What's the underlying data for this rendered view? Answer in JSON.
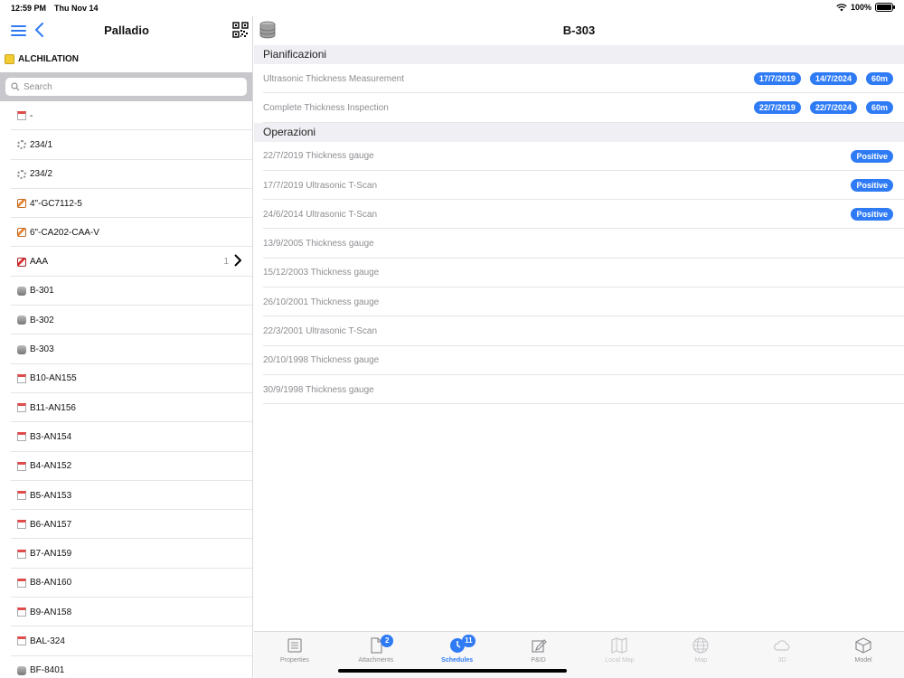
{
  "status": {
    "time": "12:59 PM",
    "date": "Thu Nov 14",
    "battery": "100%",
    "battery_level": 1.0
  },
  "sidebar": {
    "title": "Palladio",
    "plant": "ALCHILATION",
    "search_placeholder": "Search",
    "items": [
      {
        "label": "-",
        "icon": "doc-icon"
      },
      {
        "label": "234/1",
        "icon": "gear-icon"
      },
      {
        "label": "234/2",
        "icon": "gear-icon"
      },
      {
        "label": "4\"-GC7112-5",
        "icon": "pipe-icon"
      },
      {
        "label": "6\"-CA202-CAA-V",
        "icon": "pipe-icon"
      },
      {
        "label": "AAA",
        "icon": "pipe-red-icon",
        "count": "1"
      },
      {
        "label": "B-301",
        "icon": "tank-icon"
      },
      {
        "label": "B-302",
        "icon": "tank-icon"
      },
      {
        "label": "B-303",
        "icon": "tank-icon"
      },
      {
        "label": "B10-AN155",
        "icon": "doc-icon"
      },
      {
        "label": "B11-AN156",
        "icon": "doc-icon"
      },
      {
        "label": "B3-AN154",
        "icon": "doc-icon"
      },
      {
        "label": "B4-AN152",
        "icon": "doc-icon"
      },
      {
        "label": "B5-AN153",
        "icon": "doc-icon"
      },
      {
        "label": "B6-AN157",
        "icon": "doc-icon"
      },
      {
        "label": "B7-AN159",
        "icon": "doc-icon"
      },
      {
        "label": "B8-AN160",
        "icon": "doc-icon"
      },
      {
        "label": "B9-AN158",
        "icon": "doc-icon"
      },
      {
        "label": "BAL-324",
        "icon": "doc-icon"
      },
      {
        "label": "BF-8401",
        "icon": "tank-icon"
      }
    ]
  },
  "main": {
    "title": "B-303",
    "planning_header": "Pianificazioni",
    "planning": [
      {
        "name": "Ultrasonic Thickness Measurement",
        "start": "17/7/2019",
        "end": "14/7/2024",
        "interval": "60m"
      },
      {
        "name": "Complete Thickness Inspection",
        "start": "22/7/2019",
        "end": "22/7/2024",
        "interval": "60m"
      }
    ],
    "operations_header": "Operazioni",
    "operations": [
      {
        "label": "22/7/2019 Thickness gauge",
        "result": "Positive"
      },
      {
        "label": "17/7/2019 Ultrasonic T-Scan",
        "result": "Positive"
      },
      {
        "label": "24/6/2014 Ultrasonic T-Scan",
        "result": "Positive"
      },
      {
        "label": "13/9/2005 Thickness gauge",
        "result": ""
      },
      {
        "label": "15/12/2003 Thickness gauge",
        "result": ""
      },
      {
        "label": "26/10/2001 Thickness gauge",
        "result": ""
      },
      {
        "label": "22/3/2001 Ultrasonic T-Scan",
        "result": ""
      },
      {
        "label": "20/10/1998 Thickness gauge",
        "result": ""
      },
      {
        "label": "30/9/1998 Thickness gauge",
        "result": ""
      }
    ]
  },
  "tabs": [
    {
      "label": "Properties",
      "icon": "properties-icon",
      "state": "normal",
      "badge": ""
    },
    {
      "label": "Attachments",
      "icon": "attachments-icon",
      "state": "normal",
      "badge": "2"
    },
    {
      "label": "Schedules",
      "icon": "schedules-icon",
      "state": "active",
      "badge": "11"
    },
    {
      "label": "P&ID",
      "icon": "pid-icon",
      "state": "normal",
      "badge": ""
    },
    {
      "label": "Local Map",
      "icon": "local-map-icon",
      "state": "disabled",
      "badge": ""
    },
    {
      "label": "Map",
      "icon": "globe-icon",
      "state": "disabled",
      "badge": ""
    },
    {
      "label": "3D",
      "icon": "cloud-icon",
      "state": "disabled",
      "badge": ""
    },
    {
      "label": "Model",
      "icon": "cube-icon",
      "state": "normal",
      "badge": ""
    }
  ],
  "colors": {
    "accent": "#2f7bf5",
    "section_bg": "#efeff4",
    "search_bg": "#c7c7cc"
  }
}
